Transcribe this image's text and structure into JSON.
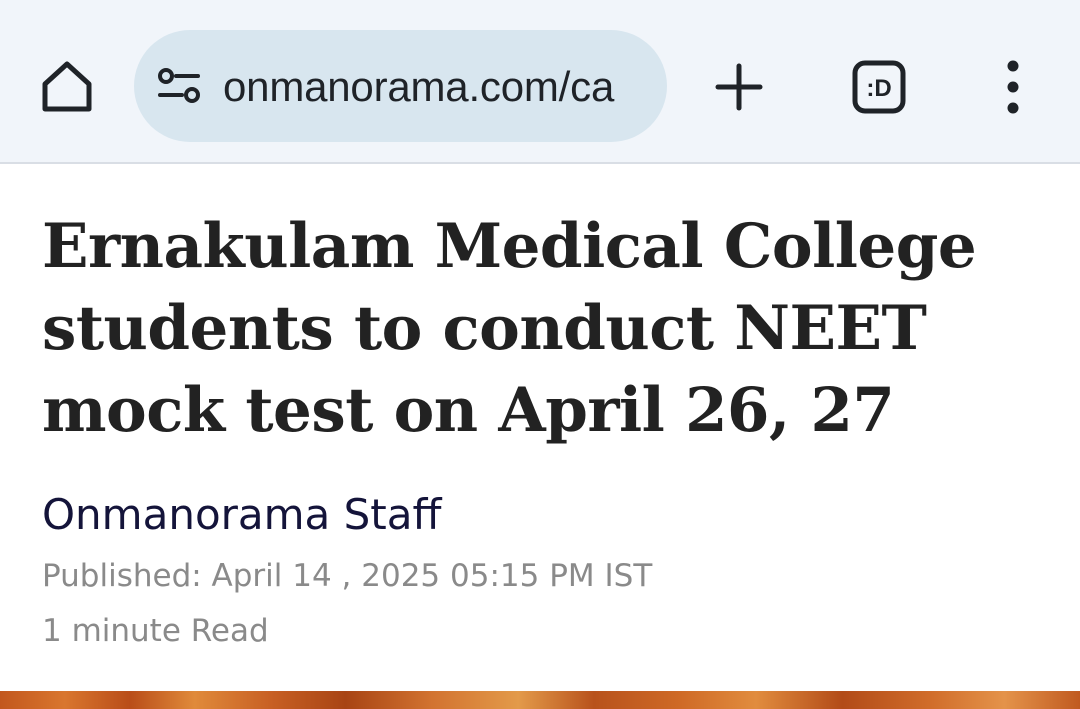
{
  "browser": {
    "url": "onmanorama.com/ca",
    "icons": {
      "home": "home-icon",
      "site_info": "tune-icon",
      "new_tab": "plus-icon",
      "dark_reader": "dark-mode-icon",
      "menu": "more-vert-icon"
    },
    "dark_badge_text": ":D",
    "colors": {
      "toolbar_bg": "#f1f5fa",
      "urlbar_bg": "#d8e6ef",
      "icon": "#1f2328"
    }
  },
  "article": {
    "headline": "Ernakulam Medical College students to conduct NEET mock test on April 26, 27",
    "author": "Onmanorama Staff",
    "published": "Published: April 14 , 2025 05:15 PM IST",
    "read_time": "1 minute Read",
    "colors": {
      "headline": "#222222",
      "author": "#14143a",
      "meta": "#8a8a8a"
    }
  }
}
